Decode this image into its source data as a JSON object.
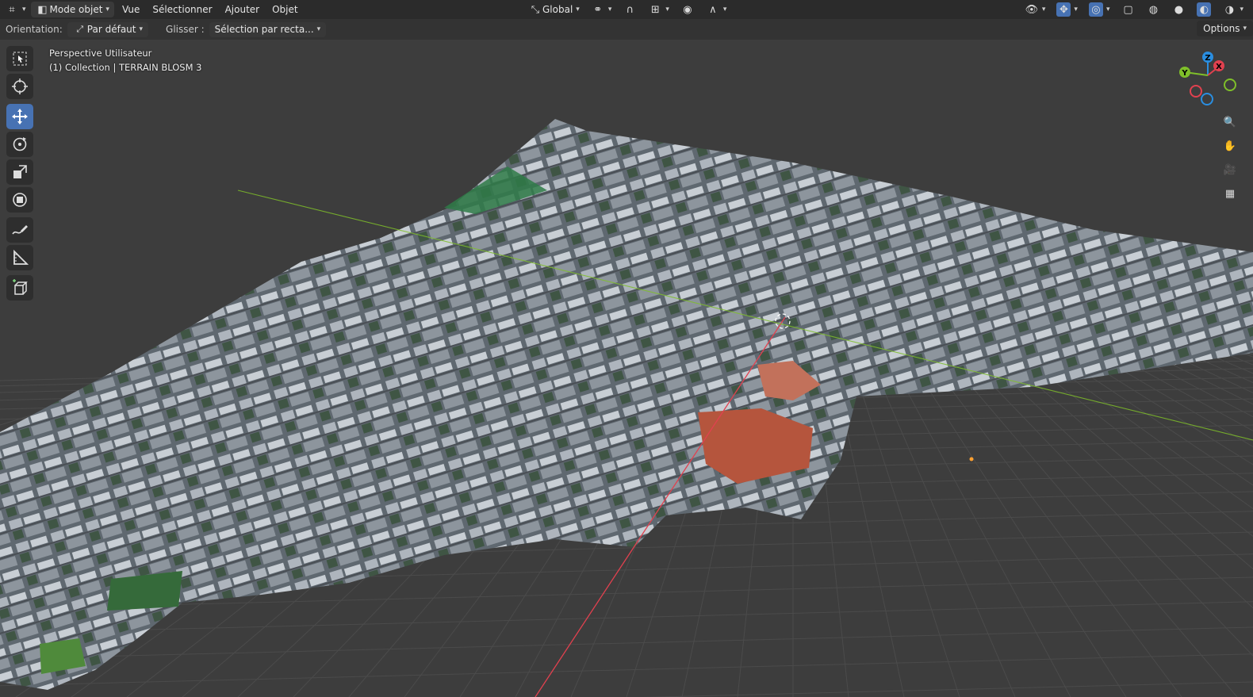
{
  "header": {
    "editor_icon": "editor-type-icon",
    "mode_label": "Mode objet",
    "menus": [
      "Vue",
      "Sélectionner",
      "Ajouter",
      "Objet"
    ],
    "transform_orientation": "Global",
    "options_label": "Options"
  },
  "tool_settings": {
    "orientation_label": "Orientation:",
    "orientation_value": "Par défaut",
    "drag_label": "Glisser :",
    "drag_value": "Sélection par recta..."
  },
  "viewport": {
    "view_name": "Perspective Utilisateur",
    "collection_info": "(1) Collection | TERRAIN BLOSM 3"
  },
  "toolbar": [
    "select-box",
    "cursor",
    "move",
    "rotate",
    "scale",
    "transform",
    "annotate",
    "measure",
    "add-cube"
  ],
  "active_tool": "move",
  "gizmo_axes": [
    "X",
    "Y",
    "Z"
  ],
  "colors": {
    "header_bg": "#2b2b2b",
    "viewport_bg": "#3d3d3d",
    "active_tool": "#4772b3",
    "axis_x": "#e1414f",
    "axis_y": "#7fbf2a",
    "axis_z": "#2a8ee0"
  }
}
